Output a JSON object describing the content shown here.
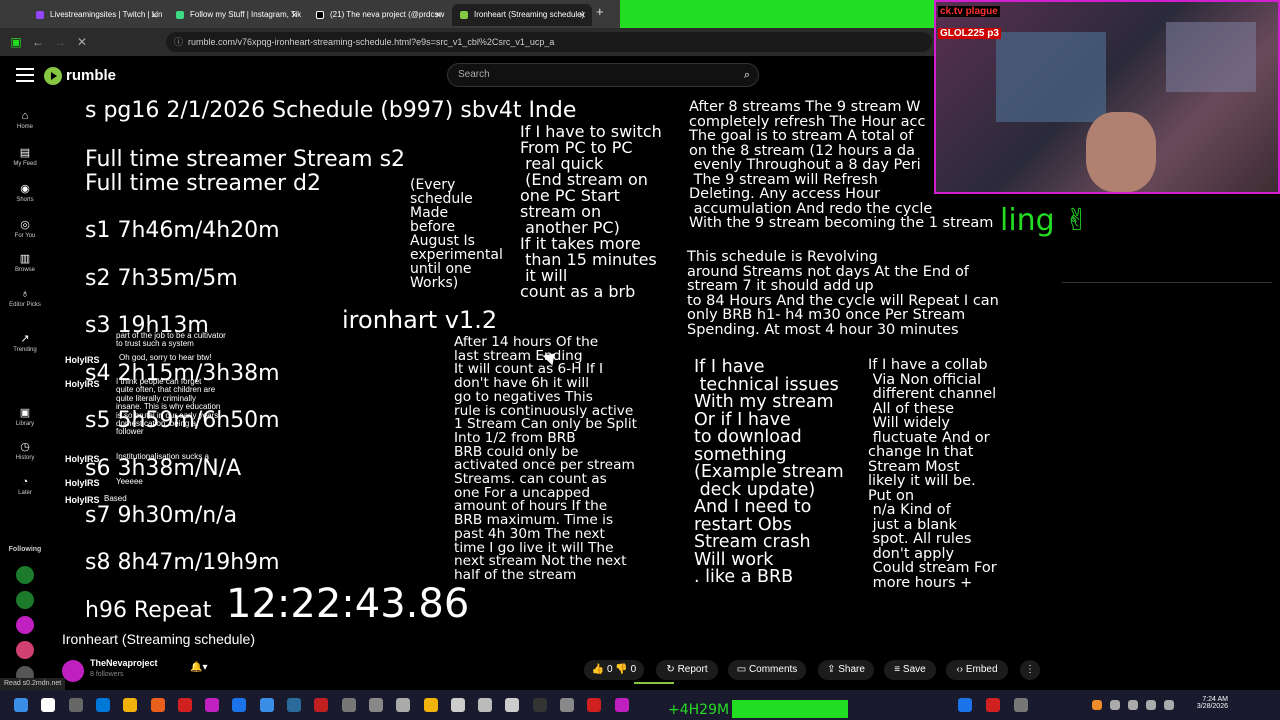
{
  "browser": {
    "tabs": [
      {
        "label": "Livestreamingsites | Twitch | Lin"
      },
      {
        "label": "Follow my Stuff | Instagram, Tik"
      },
      {
        "label": "(21) The neva project (@prdcsw"
      },
      {
        "label": "Ironheart (Streaming schedule)"
      }
    ],
    "new_tab": "+",
    "url": "rumble.com/v76xpqg-ironheart-streaming-schedule.html?e9s=src_v1_cbl%2Csrc_v1_ucp_a"
  },
  "header": {
    "logo_text": "rumble",
    "search_placeholder": "Search"
  },
  "sidebar": {
    "items": [
      {
        "label": "Home",
        "icon": "home-icon",
        "glyph": "⌂"
      },
      {
        "label": "My Feed",
        "icon": "feed-icon",
        "glyph": "▤"
      },
      {
        "label": "Shorts",
        "icon": "shorts-icon",
        "glyph": "◉"
      },
      {
        "label": "For You",
        "icon": "for-you-icon",
        "glyph": "◎"
      },
      {
        "label": "Browse",
        "icon": "browse-icon",
        "glyph": "▥"
      },
      {
        "label": "Editor Picks",
        "icon": "editor-picks-icon",
        "glyph": "♁"
      },
      {
        "label": "Trending",
        "icon": "trending-icon",
        "glyph": "↗"
      },
      {
        "label": "Library",
        "icon": "library-icon",
        "glyph": "▣"
      },
      {
        "label": "History",
        "icon": "history-icon",
        "glyph": "◷"
      },
      {
        "label": "Later",
        "icon": "later-icon",
        "glyph": "◔"
      }
    ],
    "following_label": "Following"
  },
  "video": {
    "header_line": "s pg16 2/1/2026 Schedule (b997) sbv4t Inde",
    "full_time_1": "Full time streamer Stream s2",
    "full_time_2": "Full time streamer d2",
    "schedule": [
      "s1 7h46m/4h20m",
      "s2 7h35m/5m",
      "s3 19h13m",
      "s4 2h15m/3h38m",
      "s5 5h59m/6h50m",
      "s6 3h38m/N/A",
      "s7 9h30m/n/a",
      "s8 8h47m/19h9m"
    ],
    "repeat_label": "h96 Repeat",
    "clock": "12:22:43.86",
    "version": "ironhart v1.2",
    "every_schedule": "(Every\nschedule\nMade\nbefore\nAugust Is\nexperimental\nuntil one\nWorks)",
    "switch_pc": "If I have to switch\nFrom PC to PC\n real quick\n (End stream on\none PC Start\nstream on\n another PC)\nIf it takes more\n than 15 minutes\n it will\ncount as a brb",
    "after_14": "After 14 hours Of the\nlast stream Ending\nIt will count as 6-H If I\ndon't have 6h it will\ngo to negatives This\nrule is continuously active\n1 Stream Can only be Split\nInto 1/2 from BRB\nBRB could only be\nactivated once per stream\nStreams. can count as\none For a uncapped\namount of hours If the\nBRB maximum. Time is\npast 4h 30m The next\ntime I go live it will The\nnext stream Not the next\nhalf of the stream",
    "after_8": "After 8 streams The 9 stream W\ncompletely refresh The Hour acc\nThe goal is to stream A total of\non the 8 stream (12 hours a da\n evenly Throughout a 8 day Peri\n The 9 stream will Refresh\nDeleting. Any access Hour\n accumulation And redo the cycle\nWith the 9 stream becoming the 1 stream",
    "revolving": "This schedule is Revolving\naround Streams not days At the End of\nstream 7 it should add up\nto 84 Hours And the cycle will Repeat I can\nonly BRB h1- h4 m30 once Per Stream\nSpending. At most 4 hour 30 minutes",
    "technical": "If I have\n technical issues\nWith my stream\nOr if I have\nto download\nsomething\n(Example stream\n deck update)\nAnd I need to\nrestart Obs\nStream crash\nWill work\n. like a BRB",
    "collab": "If I have a collab\n Via Non official\n different channel\n All of these\n Will widely\n fluctuate And or\nchange In that\nStream Most\nlikely it will be.\nPut on\n n/a Kind of\n just a blank\n spot. All rules\n don't apply\n Could stream For\n more hours +",
    "chat": [
      {
        "name": "HolyIRS",
        "msg": "Oh god, sorry to hear btw!"
      },
      {
        "name": "HolyIRS",
        "msg": "I think people can forget\nquite often, that children are\nquite literally criminally\ninsane. This is why education\nis so brutal in our early years.\ndomestication, being a\nfollower"
      },
      {
        "name": "HolyIRS",
        "msg": "Institutionalisation sucks a"
      },
      {
        "name": "HolyIRS",
        "msg": "Yeeeee"
      },
      {
        "name": "HolyIRS",
        "msg": "Based"
      }
    ],
    "chat_top": "part of the job to be a cultivator\nto trust such a system"
  },
  "below": {
    "title": "Ironheart (Streaming schedule)",
    "channel": "TheNevaproject",
    "followers": "8 followers",
    "like_count": "0",
    "dislike_count": "0",
    "report": "Report",
    "comments": "Comments",
    "share": "Share",
    "save": "Save",
    "embed": "Embed"
  },
  "overlay": {
    "webcam_text_1": "ck.tv plague",
    "webcam_text_2": "GLOL225 p3",
    "ling_text": "ling ✌"
  },
  "status_text": "Read s0.2mdn.net",
  "taskbar": {
    "overlay_text": "+4H29M",
    "time": "7:24 AM",
    "date": "3/28/2026"
  }
}
